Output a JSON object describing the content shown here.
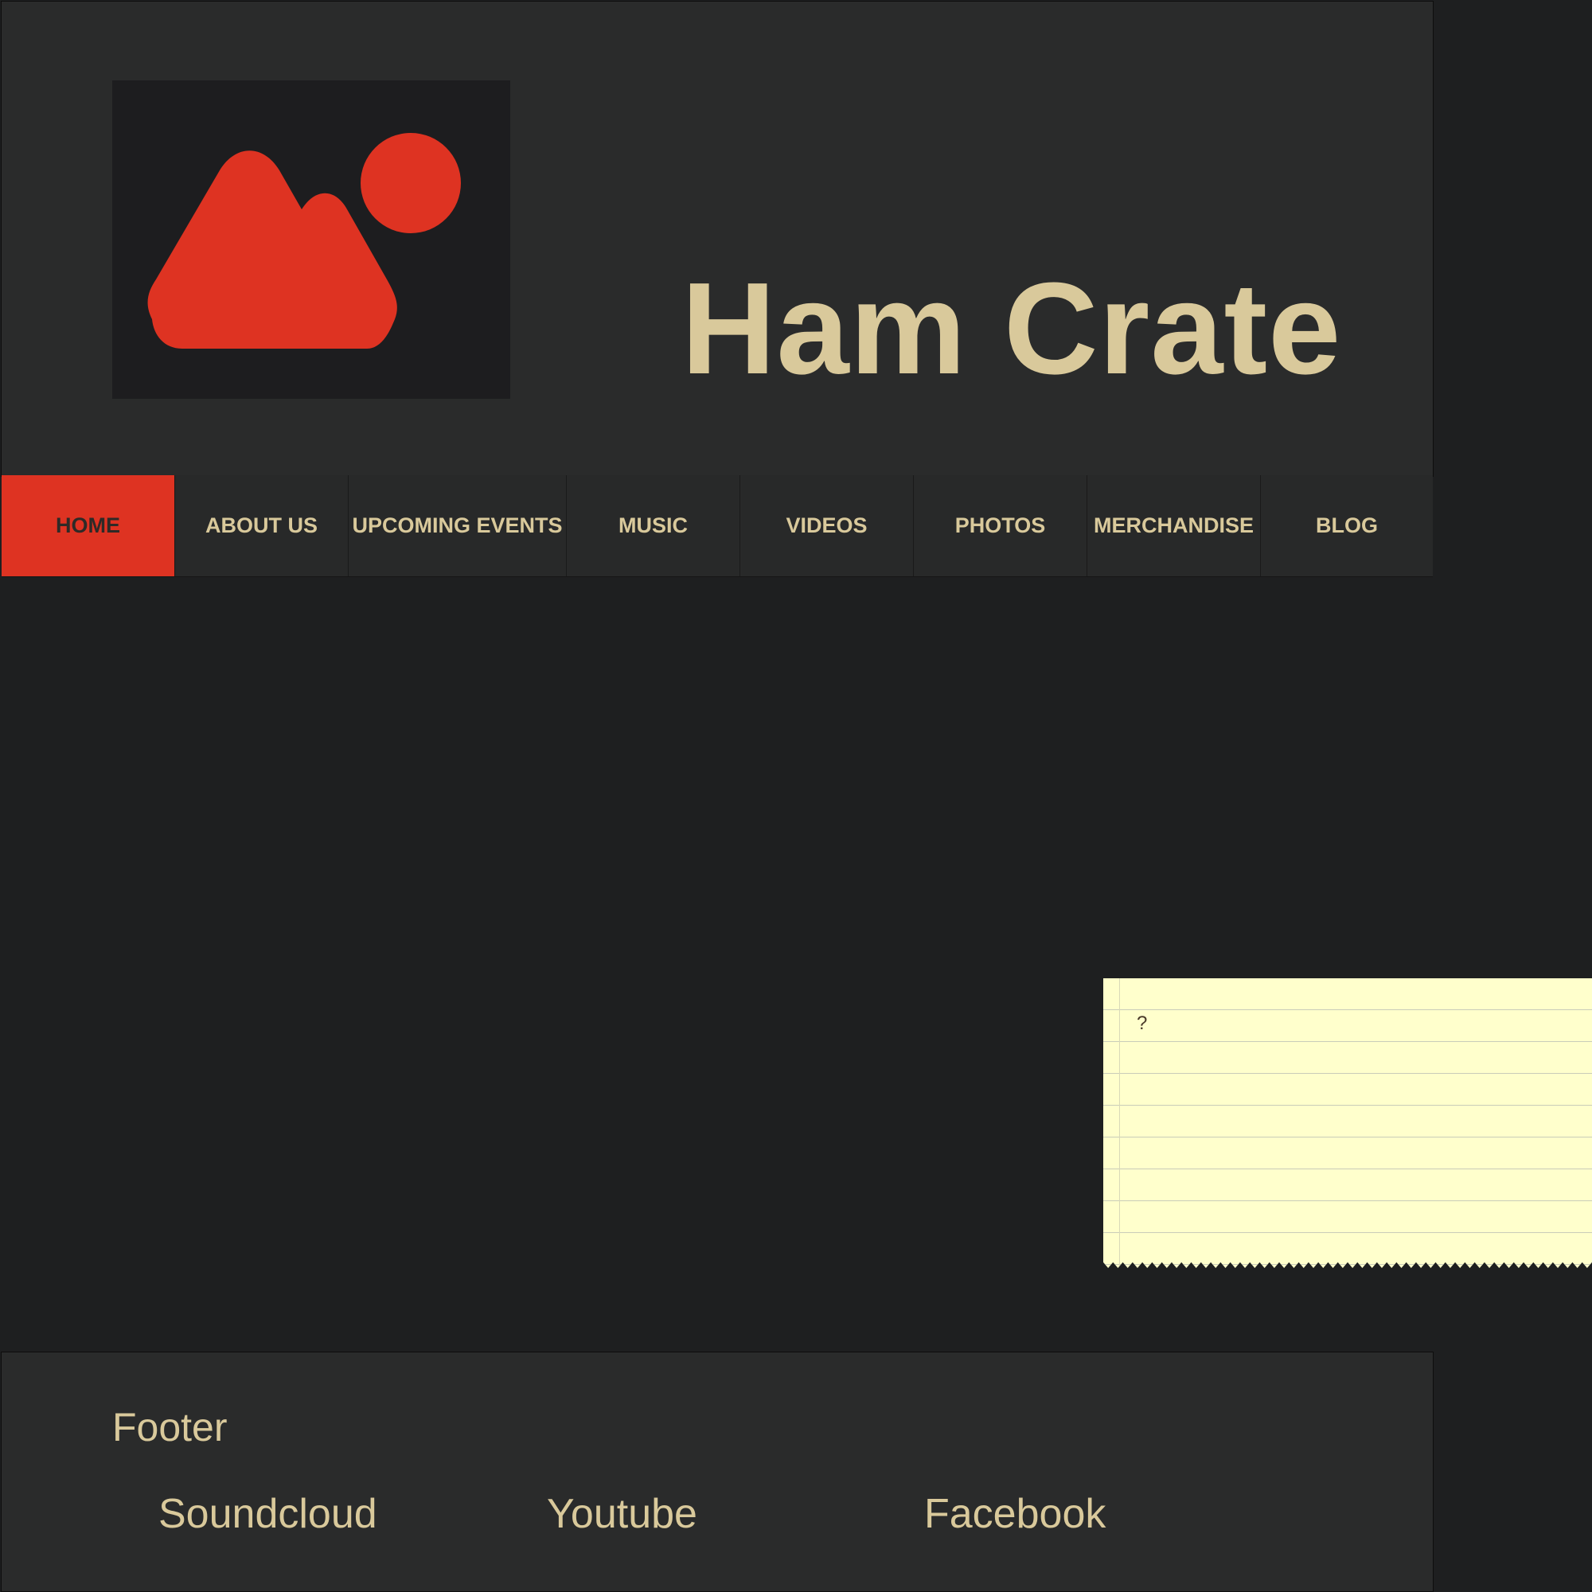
{
  "site": {
    "title": "Ham Crate",
    "logo_icon": "image-placeholder-icon"
  },
  "colors": {
    "accent": "#de3322",
    "text": "#d9c99b",
    "panel": "#2a2b2b",
    "background": "#1e1f20",
    "note": "#ffffcc"
  },
  "nav": {
    "items": [
      {
        "label": "HOME",
        "active": true
      },
      {
        "label": "ABOUT US",
        "active": false
      },
      {
        "label": "UPCOMING EVENTS",
        "active": false
      },
      {
        "label": "MUSIC",
        "active": false
      },
      {
        "label": "VIDEOS",
        "active": false
      },
      {
        "label": "PHOTOS",
        "active": false
      },
      {
        "label": "MERCHANDISE",
        "active": false
      },
      {
        "label": "BLOG",
        "active": false
      }
    ]
  },
  "note": {
    "text": "?"
  },
  "footer": {
    "title": "Footer",
    "links": [
      "Soundcloud",
      "Youtube",
      "Facebook"
    ]
  }
}
